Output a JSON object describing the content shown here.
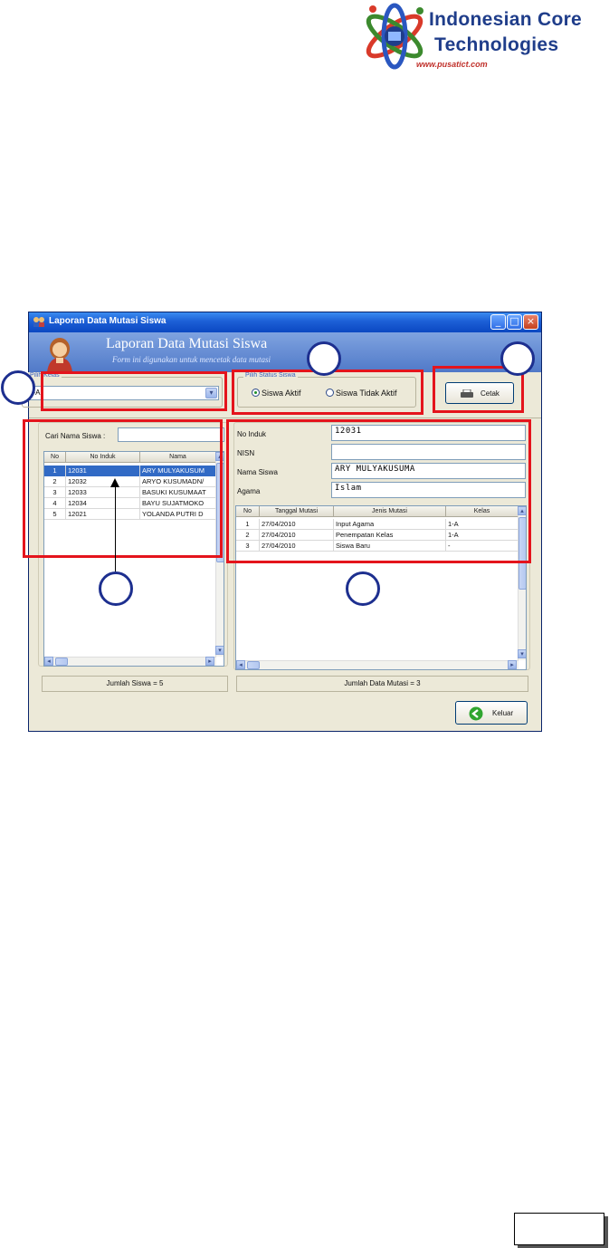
{
  "logo": {
    "line1": "Indonesian Core",
    "line2": "Technologies",
    "url": "www.pusatict.com"
  },
  "window": {
    "title": "Laporan Data Mutasi Siswa",
    "header_title": "Laporan Data Mutasi Siswa",
    "header_subtitle": "Form ini digunakan untuk mencetak data mutasi",
    "controls": {
      "min": "_",
      "max": "□",
      "close": "×"
    }
  },
  "kelas": {
    "legend": "Pilih Kelas",
    "value": "1-A"
  },
  "status": {
    "legend": "Pilih Status Siswa",
    "opt1": "Siswa Aktif",
    "opt2": "Siswa Tidak Aktif",
    "selected": "Siswa Aktif"
  },
  "cetak_label": "Cetak",
  "search": {
    "label": "Cari Nama Siswa  :",
    "value": ""
  },
  "siswa_table": {
    "columns": [
      "No",
      "No Induk",
      "Nama"
    ],
    "rows": [
      [
        "1",
        "12031",
        "ARY MULYAKUSUM"
      ],
      [
        "2",
        "12032",
        "ARYO KUSUMADN/"
      ],
      [
        "3",
        "12033",
        "BASUKI KUSUMAAT"
      ],
      [
        "4",
        "12034",
        "BAYU SUJATMOKO"
      ],
      [
        "5",
        "12021",
        "YOLANDA PUTRI D"
      ]
    ]
  },
  "detail": {
    "no_induk_label": "No Induk",
    "no_induk": "12031",
    "nisn_label": "NISN",
    "nisn": "",
    "nama_label": "Nama Siswa",
    "nama": "ARY MULYAKUSUMA",
    "agama_label": "Agama",
    "agama": "Islam"
  },
  "mutasi_table": {
    "columns": [
      "No",
      "Tanggal Mutasi",
      "Jenis Mutasi",
      "Kelas"
    ],
    "rows": [
      [
        "1",
        "27/04/2010",
        "Input Agama",
        "1-A"
      ],
      [
        "2",
        "27/04/2010",
        "Penempatan Kelas",
        "1-A"
      ],
      [
        "3",
        "27/04/2010",
        "Siswa Baru",
        "-"
      ]
    ]
  },
  "footer": {
    "jumlah_siswa": "Jumlah Siswa = 5",
    "jumlah_mutasi": "Jumlah Data Mutasi = 3",
    "keluar_label": "Keluar"
  },
  "colors": {
    "highlight": "#e4141c",
    "badge": "#1d2f8f",
    "selection": "#316ac5"
  }
}
